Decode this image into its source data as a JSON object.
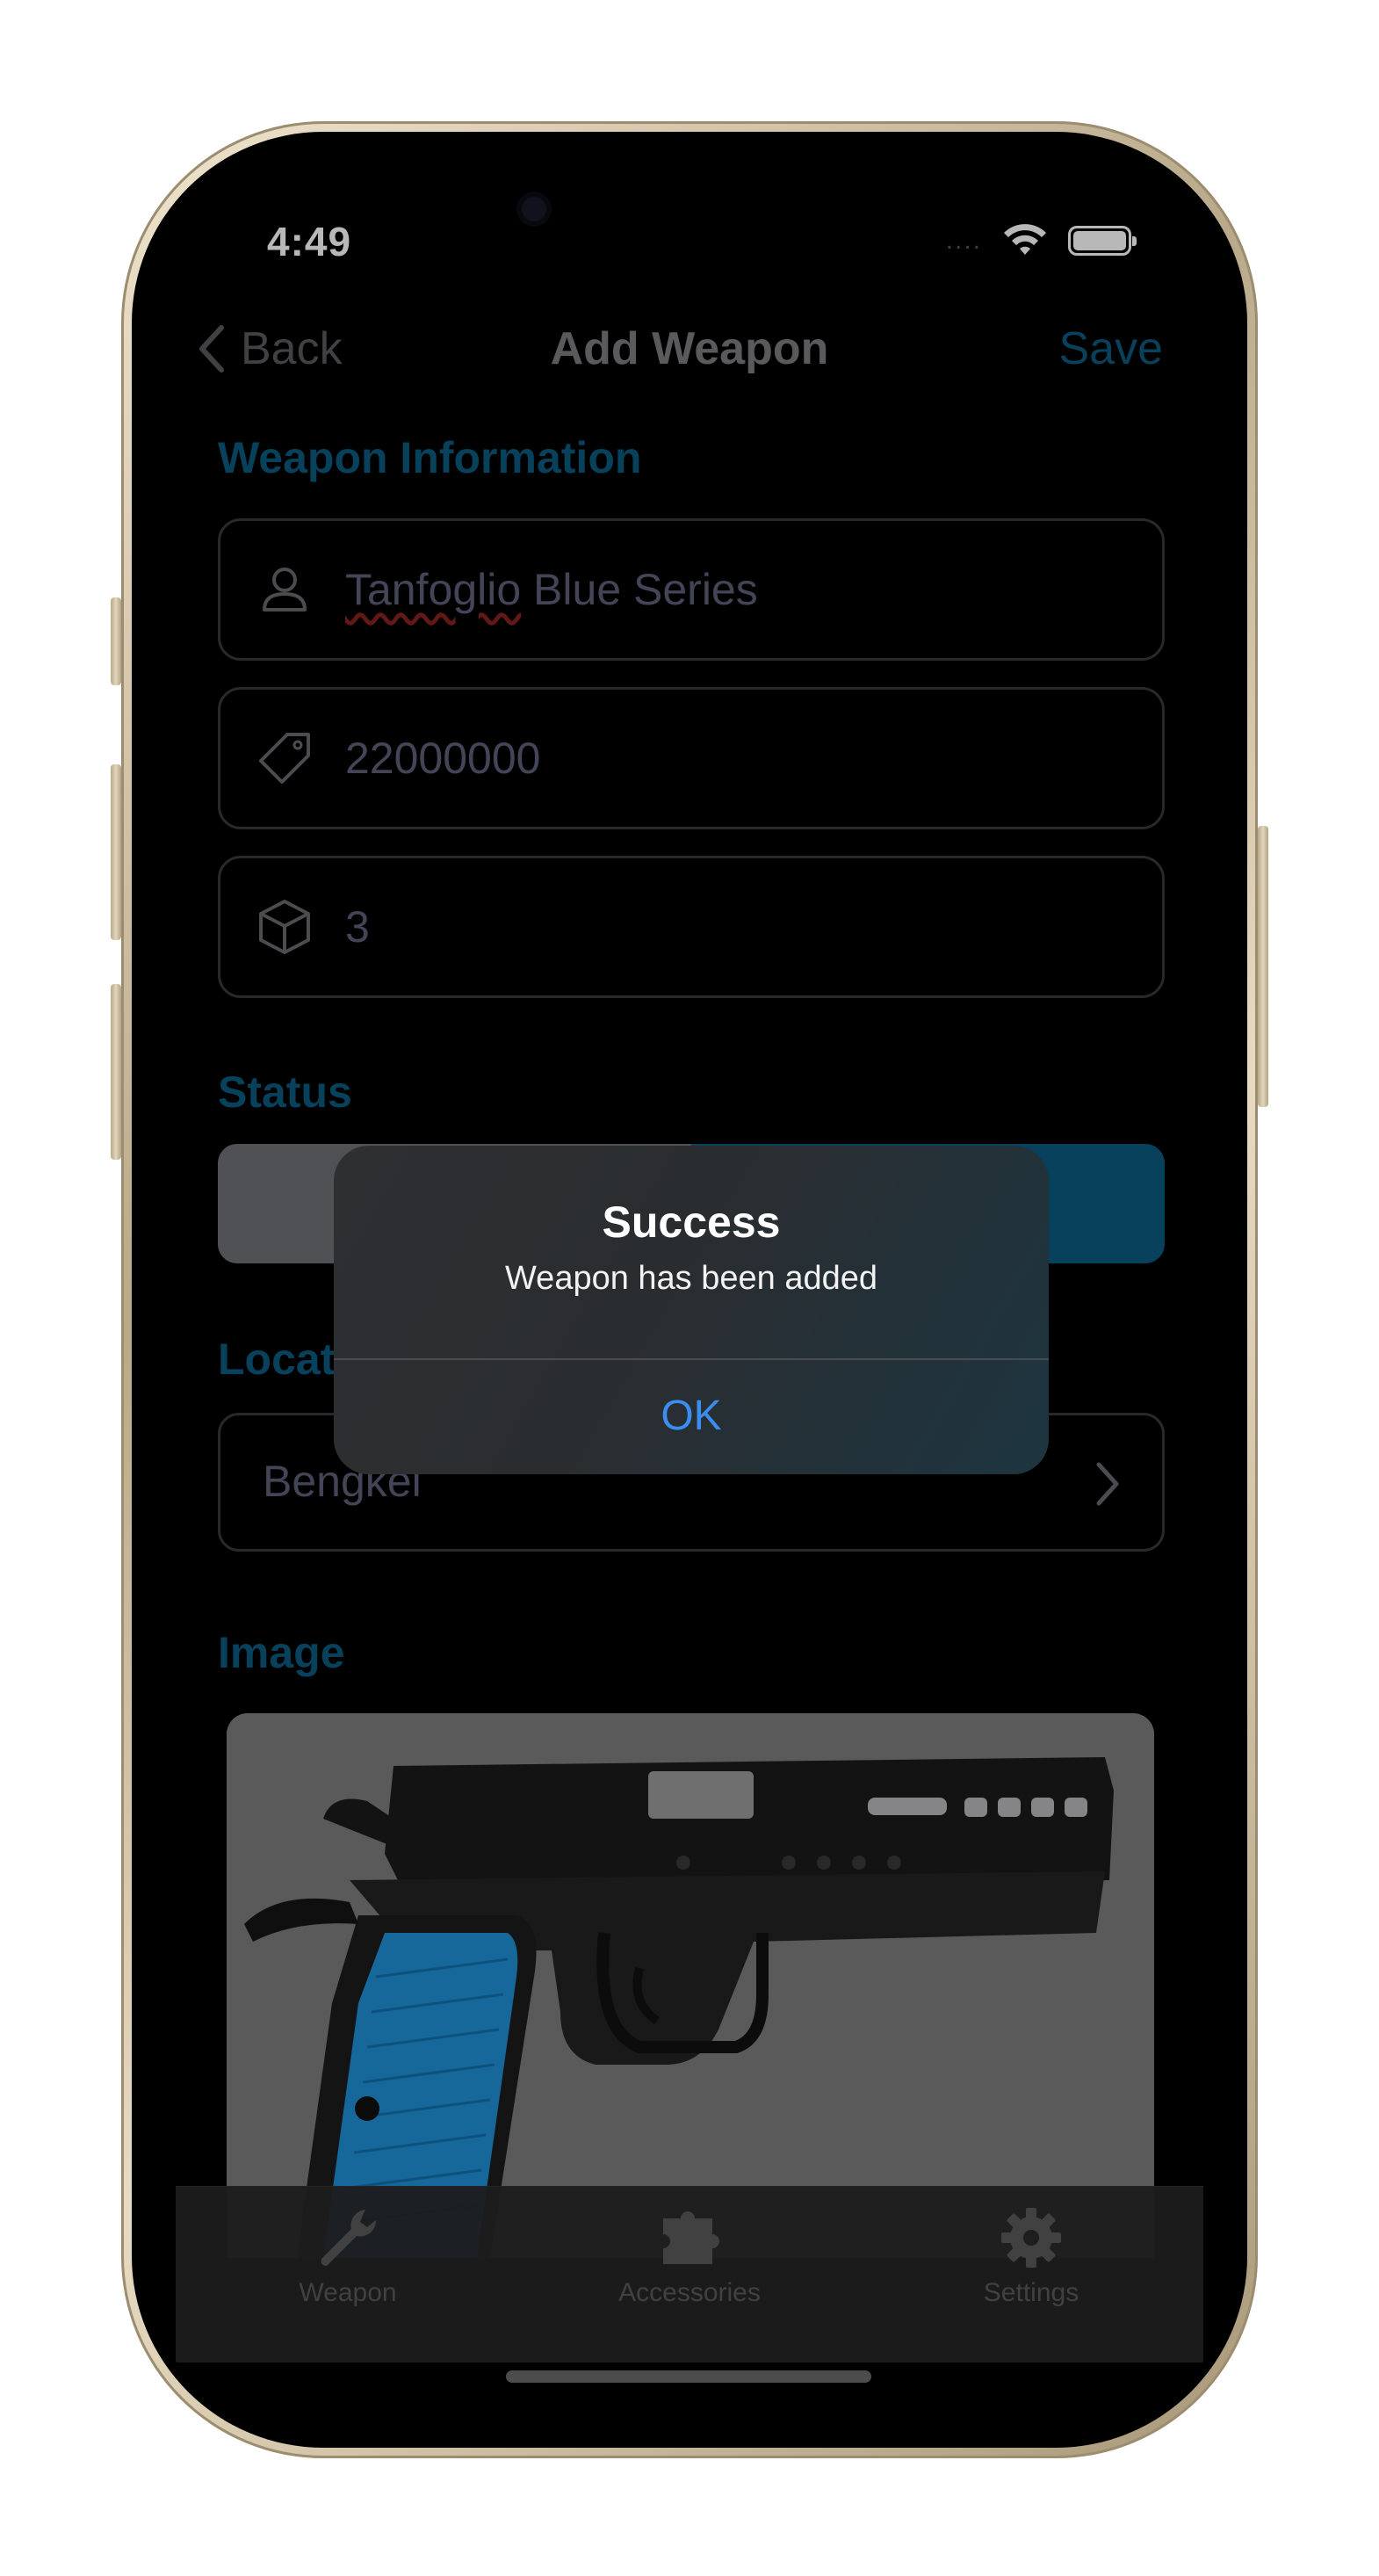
{
  "status_bar": {
    "time": "4:49",
    "signal_dots": "....",
    "icons": [
      "wifi-icon",
      "battery-icon"
    ]
  },
  "nav": {
    "back_label": "Back",
    "title": "Add Weapon",
    "save_label": "Save"
  },
  "weapon_information": {
    "section_title": "Weapon Information",
    "name_misspelled_word": "Tanfoglio",
    "name_rest": " Blue Series",
    "serial": "22000000",
    "quantity": "3",
    "icons": [
      "person-icon",
      "tag-icon",
      "box-icon"
    ]
  },
  "status": {
    "section_title": "Status"
  },
  "location": {
    "section_title": "Location",
    "value": "Bengkel"
  },
  "image_section": {
    "section_title": "Image"
  },
  "tabbar": {
    "items": [
      {
        "label": "Weapon",
        "icon": "wrench-icon"
      },
      {
        "label": "Accessories",
        "icon": "puzzle-icon"
      },
      {
        "label": "Settings",
        "icon": "gear-icon"
      }
    ]
  },
  "alert": {
    "title": "Success",
    "message": "Weapon has been added",
    "ok_label": "OK"
  },
  "colors": {
    "accent": "#0c5a7e",
    "alert_button": "#3b8ef0",
    "status_segment_left": "#707176",
    "status_segment_right": "#0a5a80",
    "grip_blue": "#1f8fd6"
  }
}
